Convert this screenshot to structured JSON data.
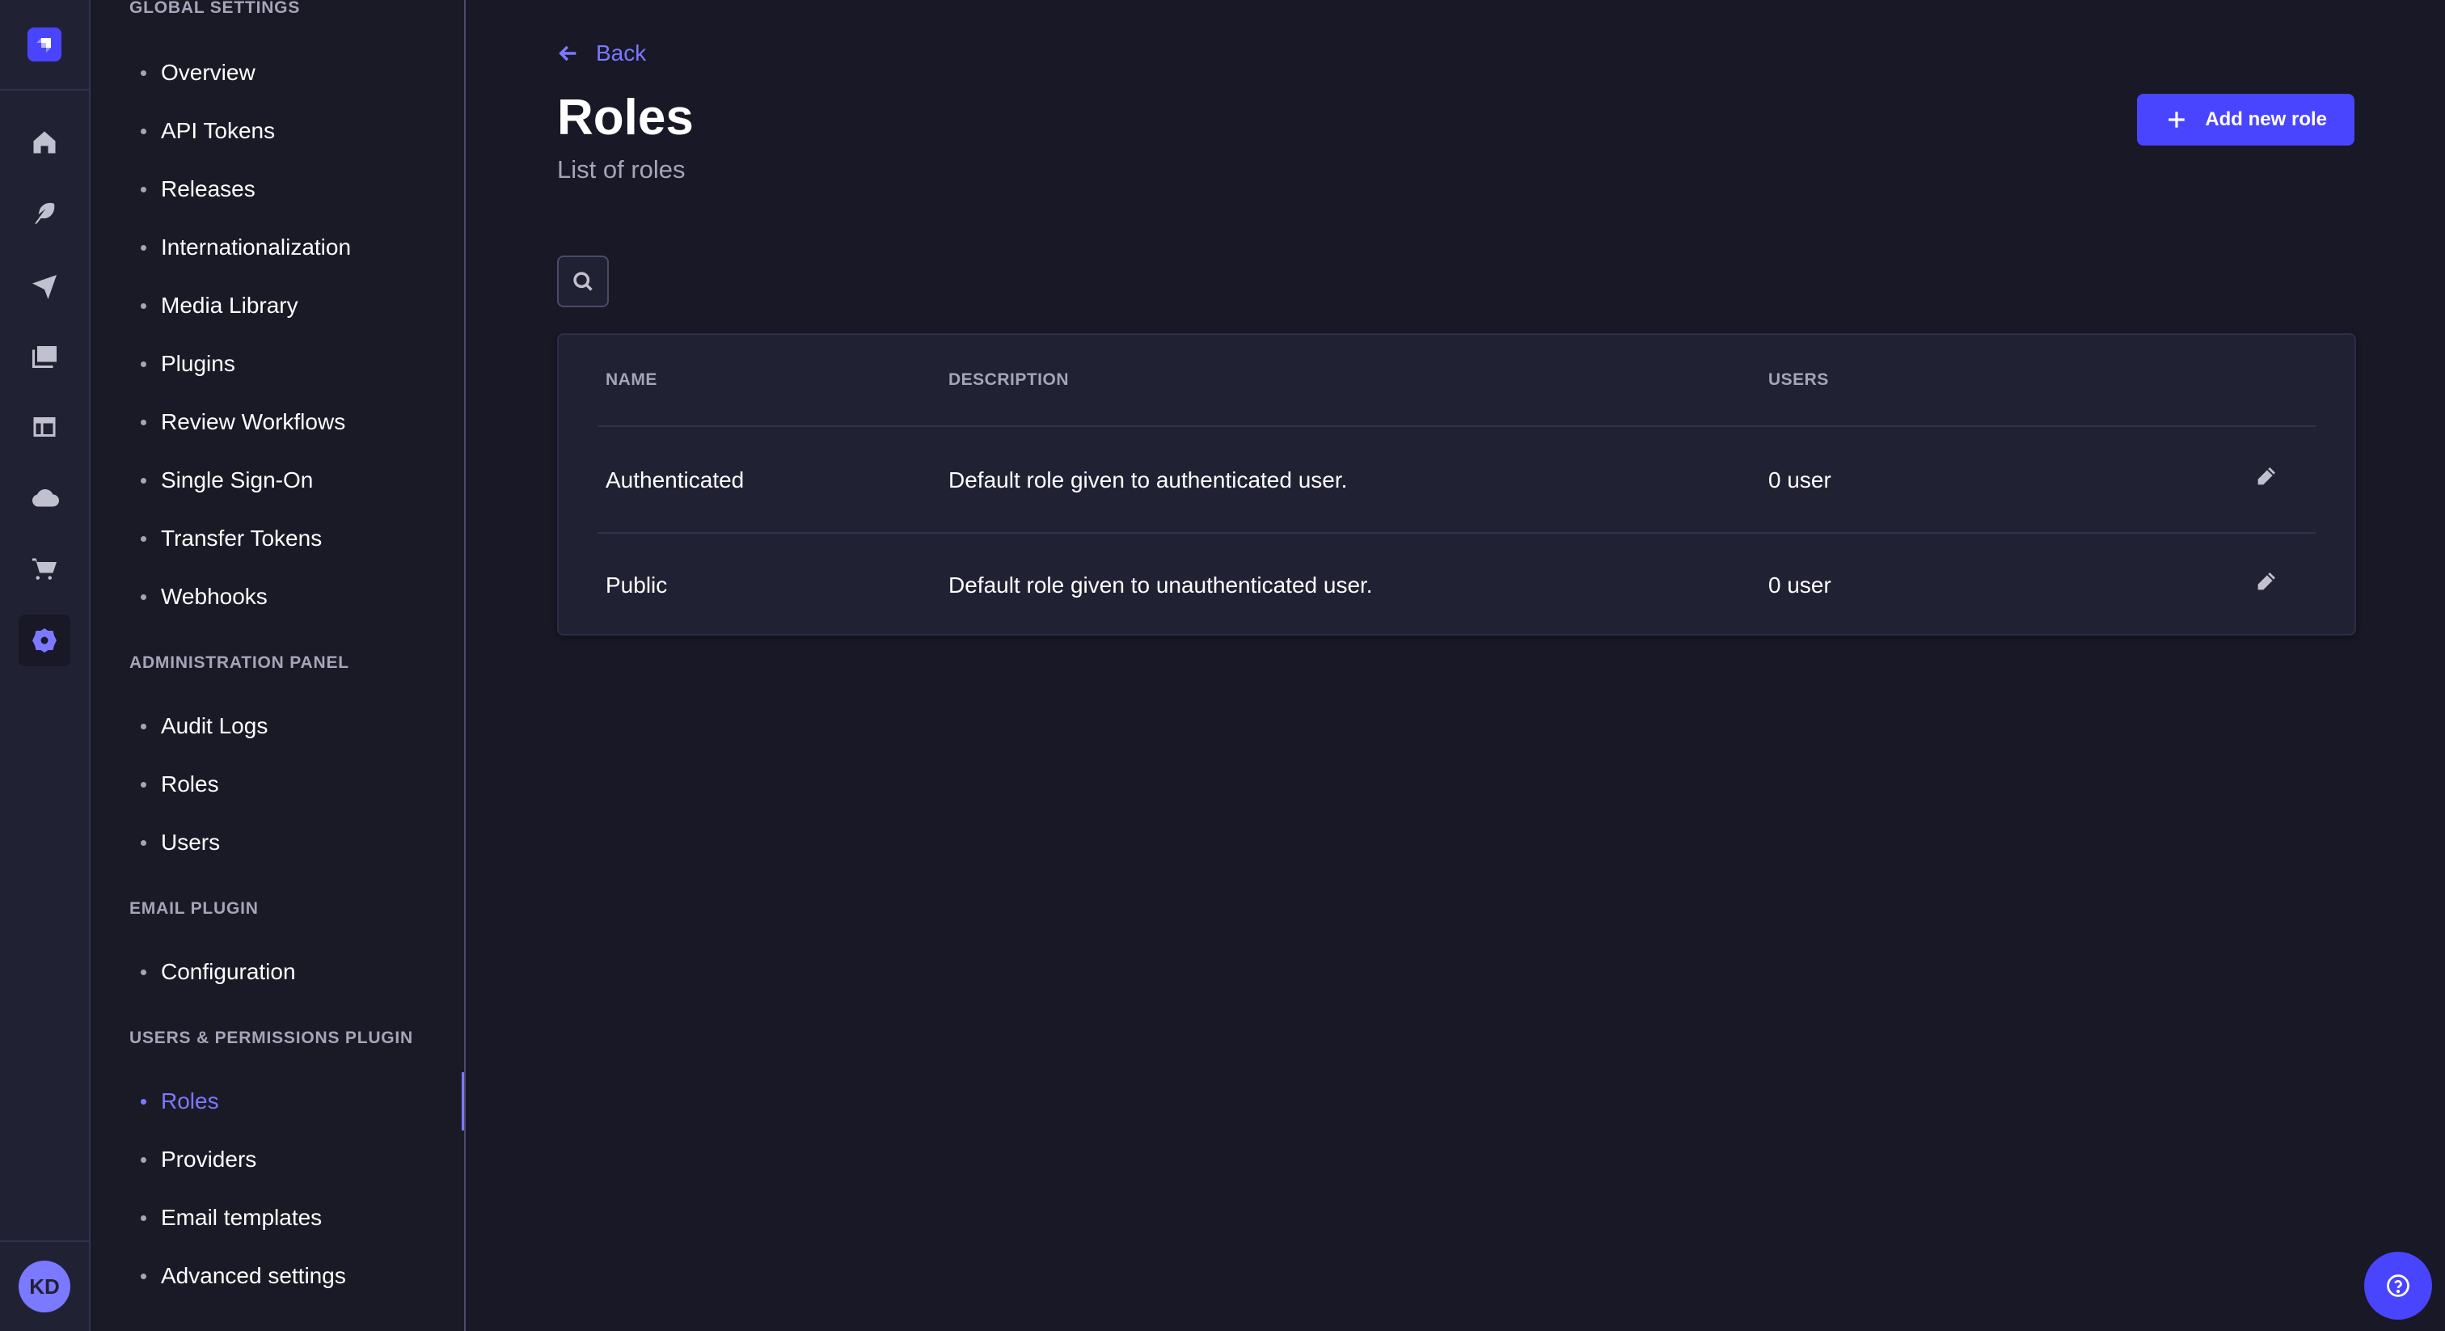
{
  "rail": {
    "logo": "strapi-logo-icon",
    "items": [
      {
        "icon": "home-icon",
        "active": false
      },
      {
        "icon": "feather-icon",
        "active": false
      },
      {
        "icon": "paper-plane-icon",
        "active": false
      },
      {
        "icon": "media-library-icon",
        "active": false
      },
      {
        "icon": "layout-icon",
        "active": false
      },
      {
        "icon": "cloud-icon",
        "active": false
      },
      {
        "icon": "shopping-cart-icon",
        "active": false
      },
      {
        "icon": "gear-icon",
        "active": true
      }
    ],
    "avatar_initials": "KD"
  },
  "subnav": {
    "sections": [
      {
        "title": "Global Settings",
        "items": [
          "Overview",
          "API Tokens",
          "Releases",
          "Internationalization",
          "Media Library",
          "Plugins",
          "Review Workflows",
          "Single Sign-On",
          "Transfer Tokens",
          "Webhooks"
        ]
      },
      {
        "title": "Administration Panel",
        "items": [
          "Audit Logs",
          "Roles",
          "Users"
        ]
      },
      {
        "title": "Email Plugin",
        "items": [
          "Configuration"
        ]
      },
      {
        "title": "Users & Permissions Plugin",
        "items": [
          "Roles",
          "Providers",
          "Email templates",
          "Advanced settings"
        ]
      }
    ],
    "active": {
      "section": 3,
      "item": 0
    }
  },
  "header": {
    "back_label": "Back",
    "title": "Roles",
    "subtitle": "List of roles",
    "add_button_label": "Add new role"
  },
  "table": {
    "columns": [
      "Name",
      "Description",
      "Users"
    ],
    "rows": [
      {
        "name": "Authenticated",
        "description": "Default role given to authenticated user.",
        "users": "0 user"
      },
      {
        "name": "Public",
        "description": "Default role given to unauthenticated user.",
        "users": "0 user"
      }
    ]
  },
  "colors": {
    "accent": "#4945ff",
    "accent_light": "#7b79ff",
    "background": "#181826",
    "surface": "#212134",
    "muted_text": "#a5a5ba"
  }
}
